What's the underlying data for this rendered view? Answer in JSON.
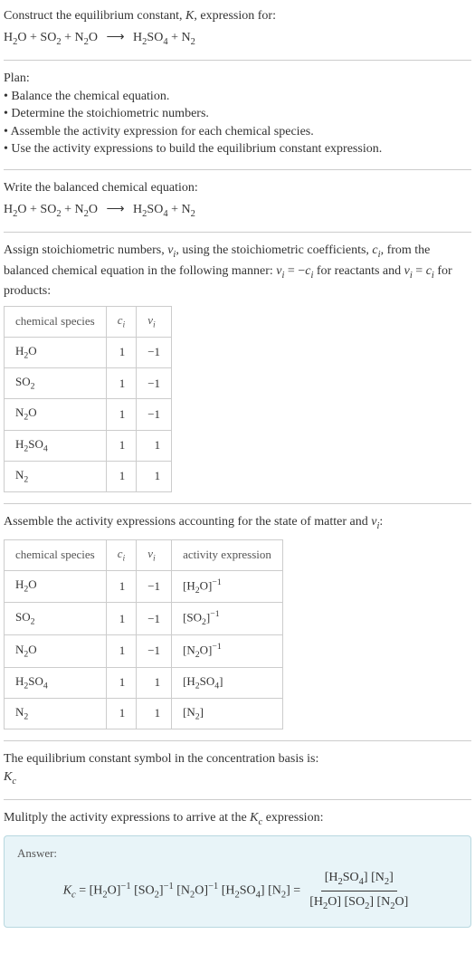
{
  "header": {
    "prompt_prefix": "Construct the equilibrium constant, ",
    "K": "K",
    "prompt_suffix": ", expression for:"
  },
  "equation": {
    "r1": "H",
    "r1s": "2",
    "r1b": "O",
    "plus1": " + ",
    "r2": "SO",
    "r2s": "2",
    "plus2": " + ",
    "r3": "N",
    "r3s": "2",
    "r3b": "O",
    "arrow": "⟶",
    "p1": "H",
    "p1s": "2",
    "p1b": "SO",
    "p1s2": "4",
    "plus3": " + ",
    "p2": "N",
    "p2s": "2"
  },
  "plan": {
    "title": "Plan:",
    "items": [
      "Balance the chemical equation.",
      "Determine the stoichiometric numbers.",
      "Assemble the activity expression for each chemical species.",
      "Use the activity expressions to build the equilibrium constant expression."
    ]
  },
  "balanced": {
    "intro": "Write the balanced chemical equation:"
  },
  "stoich": {
    "intro_a": "Assign stoichiometric numbers, ",
    "nu": "ν",
    "i": "i",
    "intro_b": ", using the stoichiometric coefficients, ",
    "c": "c",
    "intro_c": ", from the balanced chemical equation in the following manner: ",
    "rel1a": "ν",
    "rel1b": " = −",
    "rel1c": "c",
    "intro_d": " for reactants and ",
    "rel2a": "ν",
    "rel2b": " = ",
    "rel2c": "c",
    "intro_e": " for products:",
    "headers": {
      "sp": "chemical species",
      "c": "c",
      "i": "i",
      "nu": "ν"
    },
    "rows": [
      {
        "sp_html": "H<sub>2</sub>O",
        "c": "1",
        "nu": "−1"
      },
      {
        "sp_html": "SO<sub>2</sub>",
        "c": "1",
        "nu": "−1"
      },
      {
        "sp_html": "N<sub>2</sub>O",
        "c": "1",
        "nu": "−1"
      },
      {
        "sp_html": "H<sub>2</sub>SO<sub>4</sub>",
        "c": "1",
        "nu": "1"
      },
      {
        "sp_html": "N<sub>2</sub>",
        "c": "1",
        "nu": "1"
      }
    ]
  },
  "activity": {
    "intro_a": "Assemble the activity expressions accounting for the state of matter and ",
    "nu": "ν",
    "i": "i",
    "colon": ":",
    "headers": {
      "sp": "chemical species",
      "c": "c",
      "i": "i",
      "nu": "ν",
      "ae": "activity expression"
    },
    "rows": [
      {
        "sp_html": "H<sub>2</sub>O",
        "c": "1",
        "nu": "−1",
        "ae_html": "[H<sub>2</sub>O]<sup>−1</sup>"
      },
      {
        "sp_html": "SO<sub>2</sub>",
        "c": "1",
        "nu": "−1",
        "ae_html": "[SO<sub>2</sub>]<sup>−1</sup>"
      },
      {
        "sp_html": "N<sub>2</sub>O",
        "c": "1",
        "nu": "−1",
        "ae_html": "[N<sub>2</sub>O]<sup>−1</sup>"
      },
      {
        "sp_html": "H<sub>2</sub>SO<sub>4</sub>",
        "c": "1",
        "nu": "1",
        "ae_html": "[H<sub>2</sub>SO<sub>4</sub>]"
      },
      {
        "sp_html": "N<sub>2</sub>",
        "c": "1",
        "nu": "1",
        "ae_html": "[N<sub>2</sub>]"
      }
    ]
  },
  "symbol": {
    "line1": "The equilibrium constant symbol in the concentration basis is:",
    "K": "K",
    "c": "c"
  },
  "multiply": {
    "intro_a": "Mulitply the activity expressions to arrive at the ",
    "K": "K",
    "c": "c",
    "intro_b": " expression:"
  },
  "answer": {
    "label": "Answer:",
    "lhs_K": "K",
    "lhs_c": "c",
    "eq1": " = ",
    "t1": "[H",
    "t1s": "2",
    "t1b": "O]",
    "t1e": "−1",
    "t2": " [SO",
    "t2s": "2",
    "t2b": "]",
    "t2e": "−1",
    "t3": " [N",
    "t3s": "2",
    "t3b": "O]",
    "t3e": "−1",
    "t4": " [H",
    "t4s": "2",
    "t4b": "SO",
    "t4s2": "4",
    "t4c": "]",
    "t5": " [N",
    "t5s": "2",
    "t5b": "]",
    "eq2": " = ",
    "num_a": "[H",
    "num_as": "2",
    "num_ab": "SO",
    "num_as2": "4",
    "num_ac": "] [N",
    "num_bs": "2",
    "num_bc": "]",
    "den_a": "[H",
    "den_as": "2",
    "den_ab": "O] [SO",
    "den_bs": "2",
    "den_bc": "] [N",
    "den_cs": "2",
    "den_cc": "O]"
  }
}
